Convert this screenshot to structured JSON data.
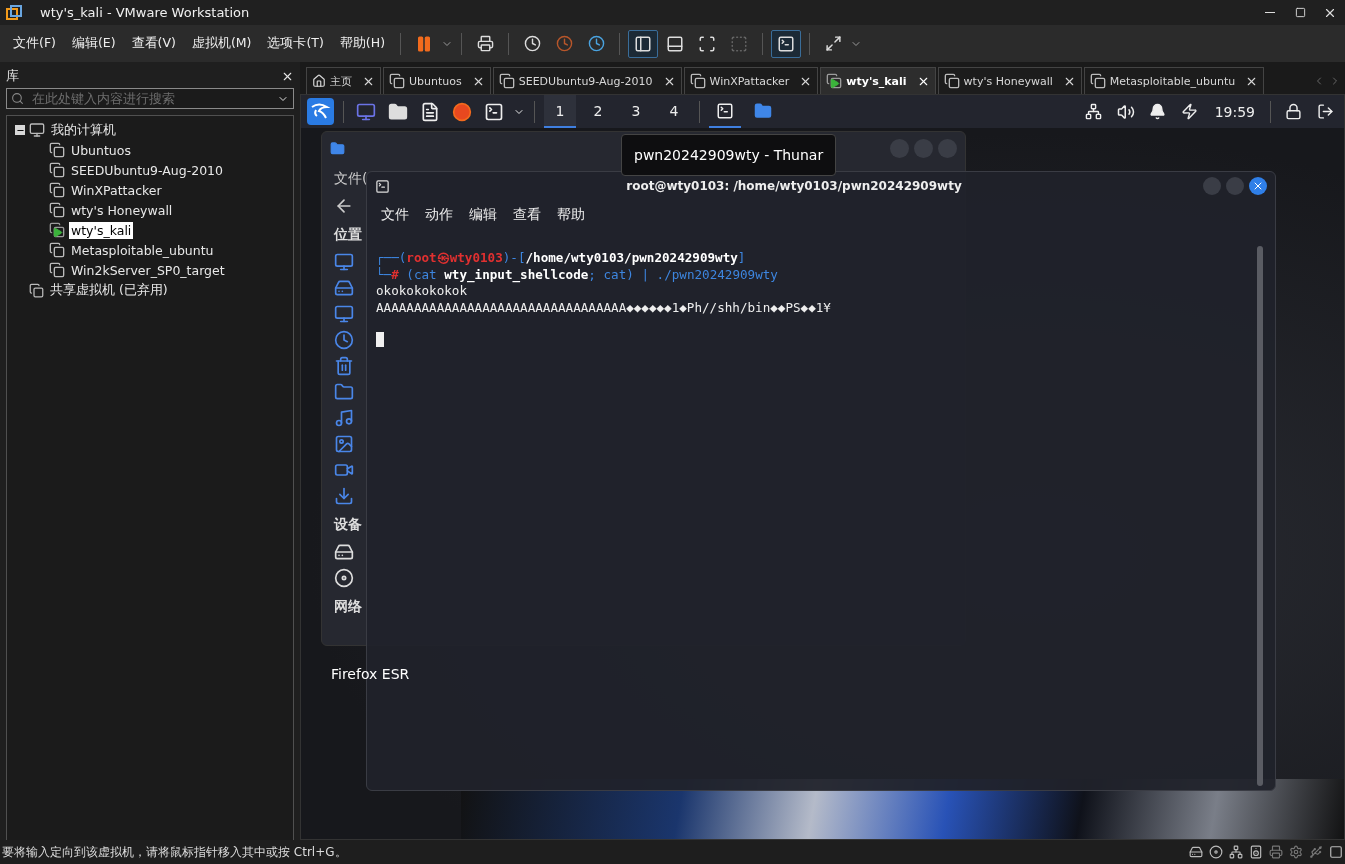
{
  "window": {
    "title": "wty's_kali - VMware Workstation"
  },
  "menu": [
    "文件(F)",
    "编辑(E)",
    "查看(V)",
    "虚拟机(M)",
    "选项卡(T)",
    "帮助(H)"
  ],
  "library": {
    "title": "库",
    "search": {
      "placeholder": "在此处键入内容进行搜索"
    },
    "tree": [
      {
        "label": "我的计算机",
        "kind": "computer",
        "expanded": true,
        "children": [
          {
            "label": "Ubuntuos",
            "kind": "vm",
            "selected": false,
            "running": false
          },
          {
            "label": "SEEDUbuntu9-Aug-2010",
            "kind": "vm",
            "selected": false,
            "running": false
          },
          {
            "label": "WinXPattacker",
            "kind": "vm",
            "selected": false,
            "running": false
          },
          {
            "label": "wty's Honeywall",
            "kind": "vm",
            "selected": false,
            "running": false
          },
          {
            "label": "wty's_kali",
            "kind": "vm",
            "selected": true,
            "running": true
          },
          {
            "label": "Metasploitable_ubuntu",
            "kind": "vm",
            "selected": false,
            "running": false
          },
          {
            "label": "Win2kServer_SP0_target",
            "kind": "vm",
            "selected": false,
            "running": false
          }
        ]
      },
      {
        "label": "共享虚拟机 (已弃用)",
        "kind": "shared"
      }
    ]
  },
  "vm_tabs": [
    {
      "label": "主页",
      "kind": "home",
      "selected": false
    },
    {
      "label": "Ubuntuos",
      "kind": "vm",
      "selected": false,
      "running": false
    },
    {
      "label": "SEEDUbuntu9-Aug-2010",
      "kind": "vm",
      "selected": false,
      "running": false
    },
    {
      "label": "WinXPattacker",
      "kind": "vm",
      "selected": false,
      "running": false
    },
    {
      "label": "wty's_kali",
      "kind": "vm",
      "selected": true,
      "running": true
    },
    {
      "label": "wty's Honeywall",
      "kind": "vm",
      "selected": false,
      "running": false
    },
    {
      "label": "Metasploitable_ubuntu",
      "kind": "vm",
      "selected": false,
      "running": false
    }
  ],
  "guest": {
    "panel": {
      "workspaces": [
        {
          "label": "1",
          "selected": true
        },
        {
          "label": "2",
          "selected": false
        },
        {
          "label": "3",
          "selected": false
        },
        {
          "label": "4",
          "selected": false
        }
      ],
      "tasks": [
        {
          "kind": "terminal",
          "selected": true
        },
        {
          "kind": "files",
          "selected": false
        }
      ],
      "clock": "19:59"
    },
    "desktop_label": "Firefox ESR",
    "thunar": {
      "menu_partial": "文件(",
      "sections": [
        "位置",
        "设备",
        "网络"
      ]
    },
    "tooltip": "pwn20242909wty - Thunar",
    "terminal": {
      "title": "root@wty0103: /home/wty0103/pwn20242909wty",
      "menu": [
        "文件",
        "动作",
        "编辑",
        "查看",
        "帮助"
      ],
      "lines": [
        {
          "segments": [
            {
              "text": "┌──(",
              "kind": "frame"
            },
            {
              "text": "root㉿wty0103",
              "kind": "user"
            },
            {
              "text": ")-[",
              "kind": "frame"
            },
            {
              "text": "/home/wty0103/pwn20242909wty",
              "kind": "path"
            },
            {
              "text": "]",
              "kind": "frame"
            }
          ]
        },
        {
          "segments": [
            {
              "text": "└─",
              "kind": "frame"
            },
            {
              "text": "# ",
              "kind": "user"
            },
            {
              "text": "(cat ",
              "kind": "cmd"
            },
            {
              "text": "wty_input_shellcode",
              "kind": "path"
            },
            {
              "text": "; cat) | ./pwn20242909wty",
              "kind": "cmd"
            }
          ]
        },
        {
          "segments": [
            {
              "text": "okokokokokok",
              "kind": "plain"
            }
          ]
        },
        {
          "segments": [
            {
              "text": "AAAAAAAAAAAAAAAAAAAAAAAAAAAAAAAAA◆◆◆◆◆◆1◆Ph//shh/bin◆◆PS◆◆1¥",
              "kind": "plain"
            }
          ]
        }
      ],
      "cursor": true
    }
  },
  "status_bar": {
    "text": "要将输入定向到该虚拟机，请将鼠标指针移入其中或按 Ctrl+G。"
  }
}
